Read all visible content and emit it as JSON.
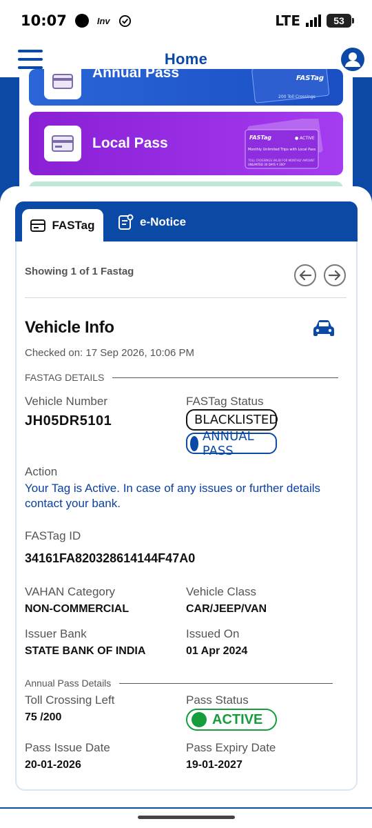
{
  "status_bar": {
    "time": "10:07",
    "inv_label": "Inv",
    "network": "LTE",
    "battery": "53"
  },
  "header": {
    "title": "Home"
  },
  "cards": {
    "annual_pass": "Annual Pass",
    "local_pass": "Local Pass"
  },
  "tabs": {
    "fastag": "FASTag",
    "enotice": "e-Notice"
  },
  "pager": {
    "showing": "Showing 1 of 1 Fastag"
  },
  "vehicle_info": {
    "title": "Vehicle Info",
    "checked_on": "Checked on: 17 Sep 2026, 10:06 PM",
    "section_fastag_details": "FASTAG DETAILS",
    "vehicle_number_label": "Vehicle Number",
    "vehicle_number": "JH05DR5101",
    "fastag_status_label": "FASTag Status",
    "status_badges": [
      "BLACKLISTED",
      "ANNUAL PASS"
    ],
    "action_label": "Action",
    "action_text": "Your Tag is Active. In case of any issues or further details contact your bank.",
    "fastag_id_label": "FASTag ID",
    "fastag_id": "34161FA820328614144F47A0",
    "vahan_category_label": "VAHAN Category",
    "vahan_category": "NON-COMMERCIAL",
    "vehicle_class_label": "Vehicle Class",
    "vehicle_class": "CAR/JEEP/VAN",
    "issuer_bank_label": "Issuer Bank",
    "issuer_bank": "STATE BANK OF INDIA",
    "issued_on_label": "Issued On",
    "issued_on": "01 Apr 2024"
  },
  "annual_pass_details": {
    "section_title": "Annual Pass Details",
    "toll_left_label": "Toll Crossing Left",
    "toll_left": "75 /200",
    "pass_status_label": "Pass Status",
    "pass_status": "ACTIVE",
    "issue_date_label": "Pass Issue Date",
    "issue_date": "20-01-2026",
    "expiry_date_label": "Pass Expiry Date",
    "expiry_date": "19-01-2027"
  },
  "colors": {
    "primary_blue": "#0a4aa6",
    "local_pass_purple": "#9b32e8",
    "active_green": "#159c3c"
  }
}
